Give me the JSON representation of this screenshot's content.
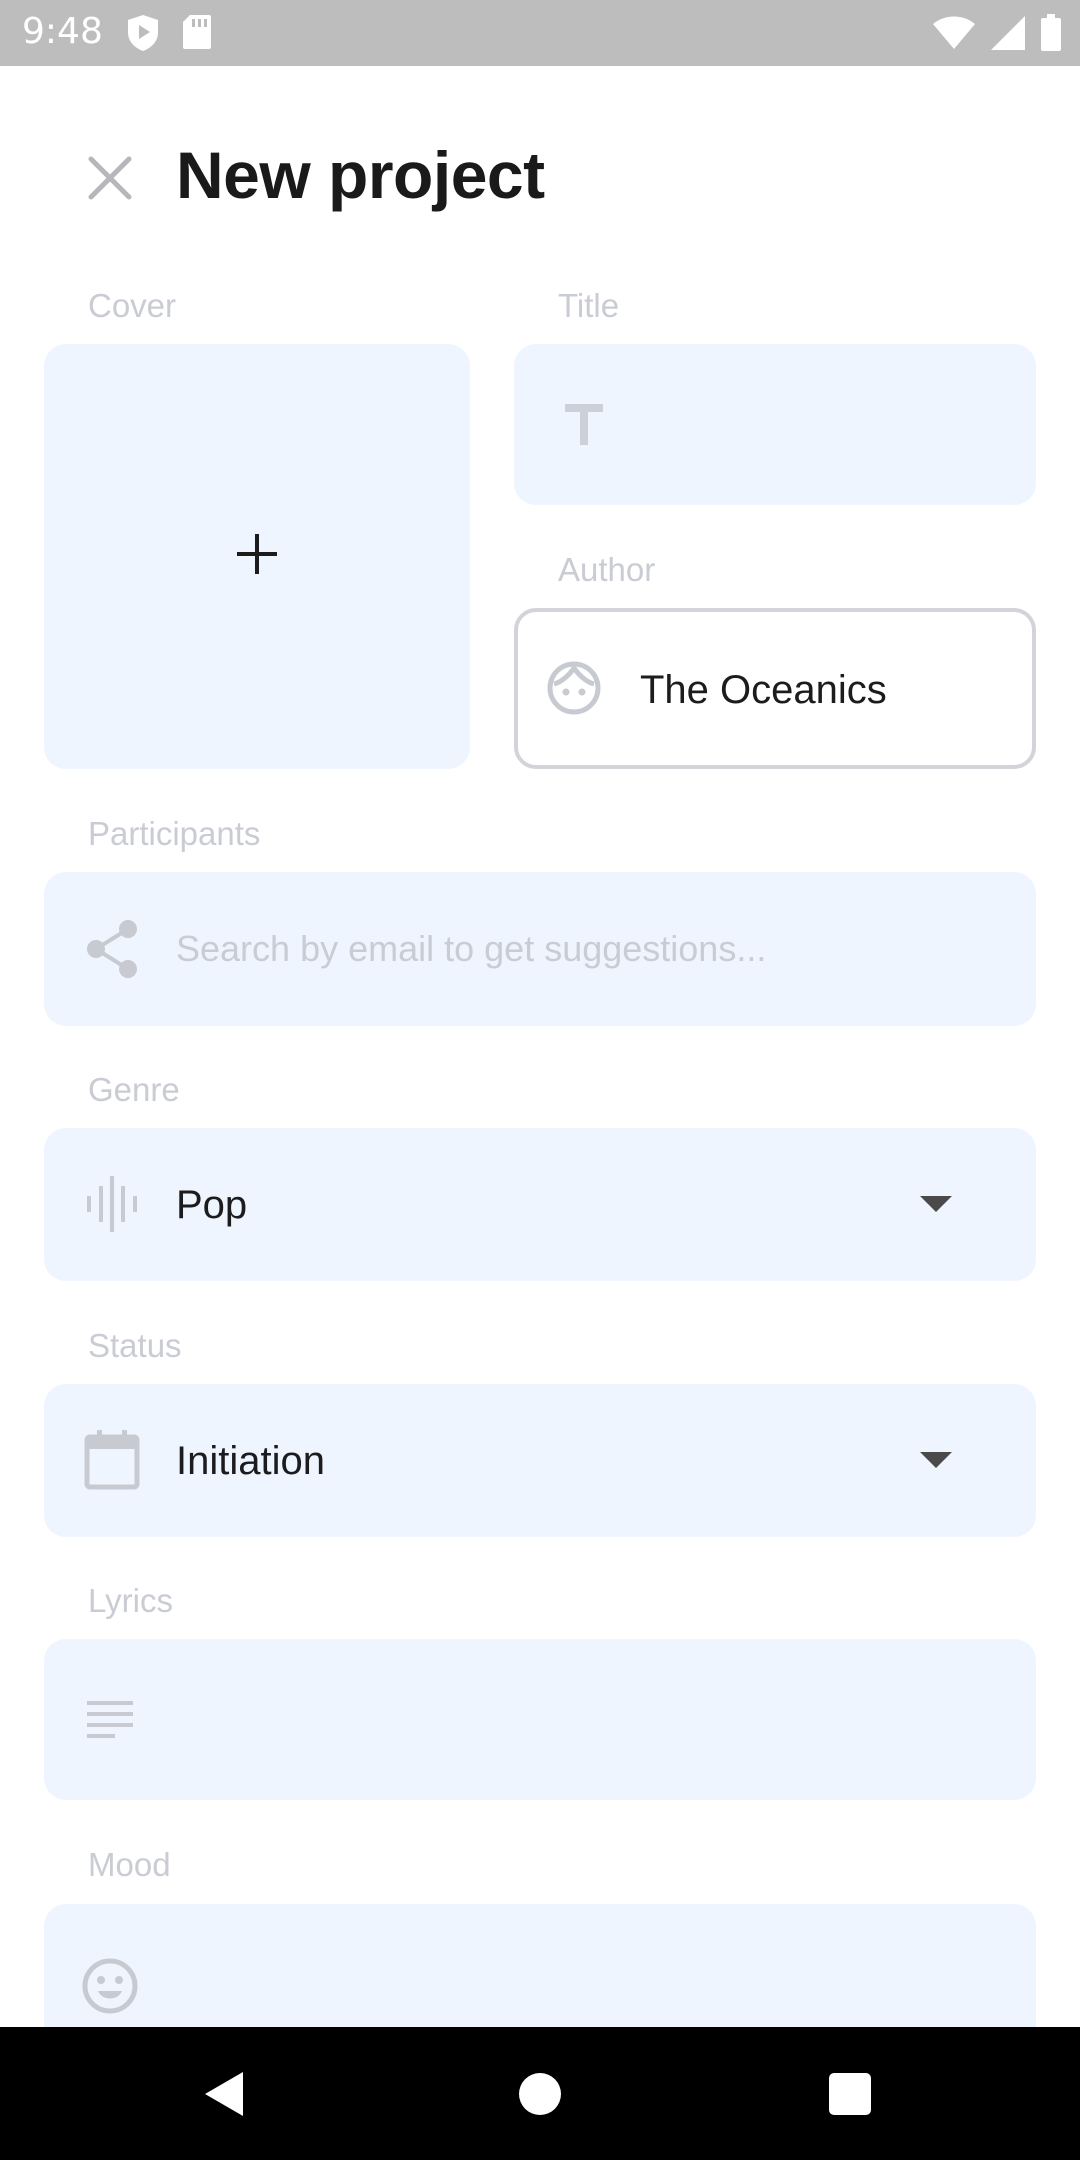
{
  "status_bar": {
    "time": "9:48",
    "left_icons": [
      "shield-play-icon",
      "sd-card-icon"
    ],
    "right_icons": [
      "wifi-icon",
      "cell-signal-icon",
      "battery-icon"
    ]
  },
  "header": {
    "close_icon": "close-icon",
    "title": "New project"
  },
  "form": {
    "cover": {
      "label": "Cover",
      "icon": "plus-icon"
    },
    "title": {
      "label": "Title",
      "icon": "text-t-icon",
      "value": ""
    },
    "author": {
      "label": "Author",
      "icon": "face-icon",
      "value": "The Oceanics"
    },
    "participants": {
      "label": "Participants",
      "icon": "share-icon",
      "placeholder": "Search by email to get suggestions..."
    },
    "genre": {
      "label": "Genre",
      "icon": "waveform-icon",
      "value": "Pop"
    },
    "status": {
      "label": "Status",
      "icon": "calendar-icon",
      "value": "Initiation"
    },
    "lyrics": {
      "label": "Lyrics",
      "icon": "notes-icon",
      "value": ""
    },
    "mood": {
      "label": "Mood",
      "icon": "smiley-icon",
      "value": ""
    }
  },
  "colors": {
    "field_bg": "#eff5ff",
    "label": "#c9ccd3",
    "status_bar_bg": "#bdbdbd",
    "nav_bar_bg": "#000000"
  }
}
